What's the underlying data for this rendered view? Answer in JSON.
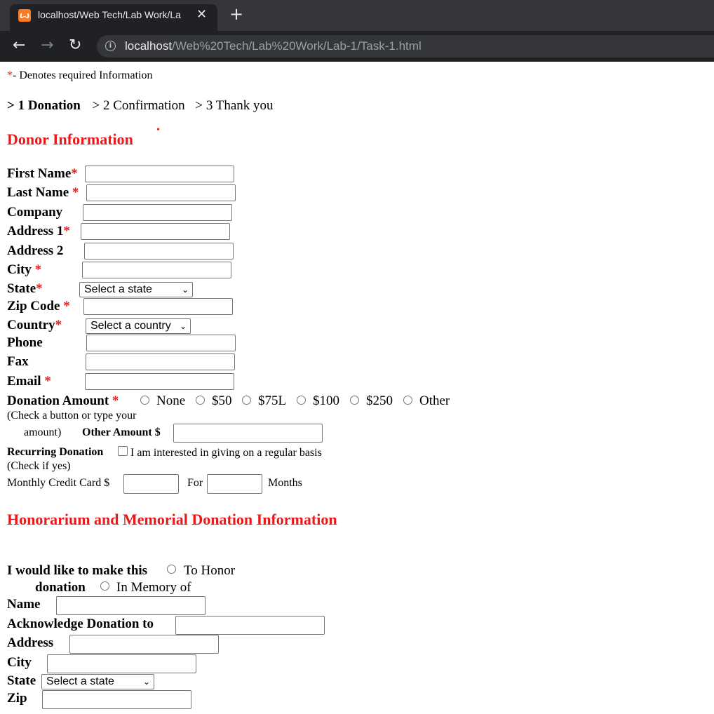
{
  "browser": {
    "tab_title": "localhost/Web Tech/Lab Work/La",
    "url_host": "localhost",
    "url_path": "/Web%20Tech/Lab%20Work/Lab-1/Task-1.html"
  },
  "required_note": {
    "star": "*",
    "text": "- Denotes required Information"
  },
  "steps": [
    "> 1 Donation",
    "> 2 Confirmation",
    "> 3 Thank you"
  ],
  "donor": {
    "heading": "Donor Information",
    "dot": "•",
    "fields": {
      "first_name": "First Name",
      "last_name": "Last Name",
      "company": "Company",
      "address1": "Address 1",
      "address2": "Address 2",
      "city": "City",
      "state": "State",
      "zip": "Zip Code",
      "country": "Country",
      "phone": "Phone",
      "fax": "Fax",
      "email": "Email"
    },
    "state_select": "Select a state",
    "country_select": "Select a country"
  },
  "donation": {
    "label": "Donation Amount",
    "options": [
      "None",
      "$50",
      "$75L",
      "$100",
      "$250",
      "Other"
    ],
    "hint_line1": "(Check a button or type your",
    "hint_line2": "amount)",
    "other_label": "Other Amount $",
    "recurring_label": "Recurring Donation",
    "recurring_check": "I am interested in giving on a regular basis",
    "check_hint": "(Check if yes)",
    "monthly_label": "Monthly Credit Card $",
    "for_label": "For",
    "months_label": "Months"
  },
  "honor": {
    "heading": "Honorarium and Memorial Donation Information",
    "make_line1": "I would like to make this",
    "make_line2": "donation",
    "opt_honor": "To Honor",
    "opt_memory": "In Memory of",
    "name": "Name",
    "acknowledge": "Acknowledge Donation to",
    "address": "Address",
    "city": "City",
    "state": "State",
    "zip": "Zip",
    "state_select": "Select a state"
  },
  "icons": {
    "back": "back-arrow-icon",
    "forward": "forward-arrow-icon",
    "reload": "reload-icon",
    "info": "info-icon",
    "close": "close-icon",
    "add": "new-tab-icon"
  }
}
